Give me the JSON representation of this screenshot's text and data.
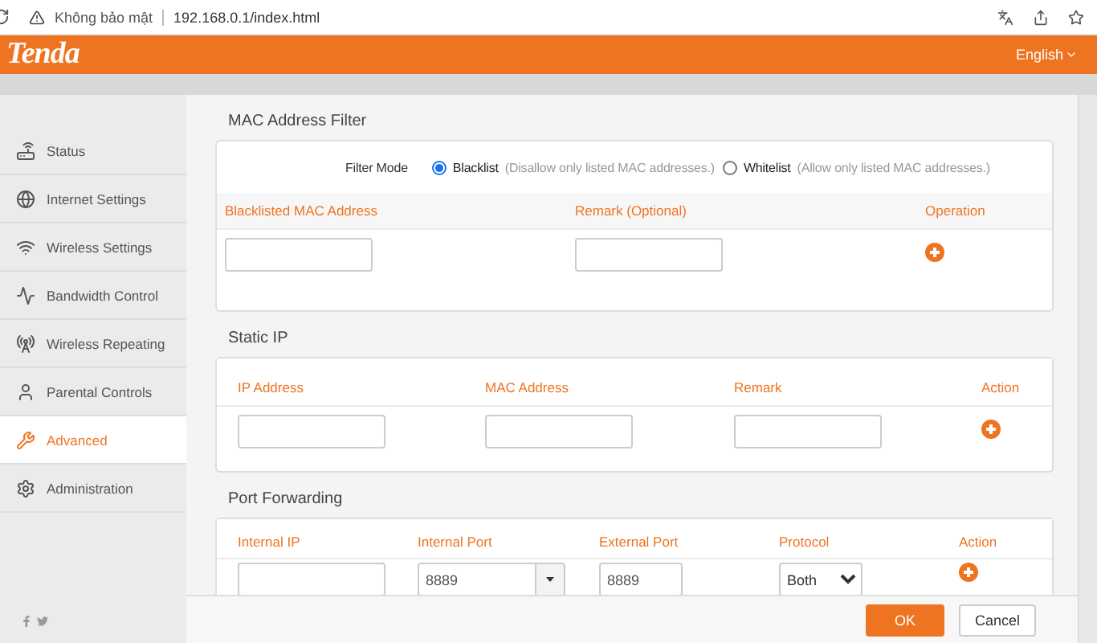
{
  "browser": {
    "security": "Không bảo mật",
    "url": "192.168.0.1/index.html"
  },
  "header": {
    "logo": "Tenda",
    "language": "English"
  },
  "sidebar": {
    "items": [
      {
        "label": "Status",
        "selected": false
      },
      {
        "label": "Internet Settings",
        "selected": false
      },
      {
        "label": "Wireless Settings",
        "selected": false
      },
      {
        "label": "Bandwidth Control",
        "selected": false
      },
      {
        "label": "Wireless Repeating",
        "selected": false
      },
      {
        "label": "Parental Controls",
        "selected": false
      },
      {
        "label": "Advanced",
        "selected": true
      },
      {
        "label": "Administration",
        "selected": false
      }
    ]
  },
  "mac_filter": {
    "title": "MAC Address Filter",
    "filter_mode_label": "Filter Mode",
    "options": [
      {
        "label": "Blacklist",
        "hint": "(Disallow only listed MAC addresses.)",
        "selected": true
      },
      {
        "label": "Whitelist",
        "hint": "(Allow only listed MAC addresses.)",
        "selected": false
      }
    ],
    "columns": [
      "Blacklisted MAC Address",
      "Remark (Optional)",
      "Operation"
    ]
  },
  "static_ip": {
    "title": "Static IP",
    "columns": [
      "IP Address",
      "MAC Address",
      "Remark",
      "Action"
    ]
  },
  "port_forwarding": {
    "title": "Port Forwarding",
    "columns": [
      "Internal IP",
      "Internal Port",
      "External Port",
      "Protocol",
      "Action"
    ],
    "row": {
      "internal_port": "8889",
      "external_port": "8889",
      "protocol": "Both"
    }
  },
  "footer": {
    "buttons": [
      "OK",
      "Cancel"
    ]
  }
}
